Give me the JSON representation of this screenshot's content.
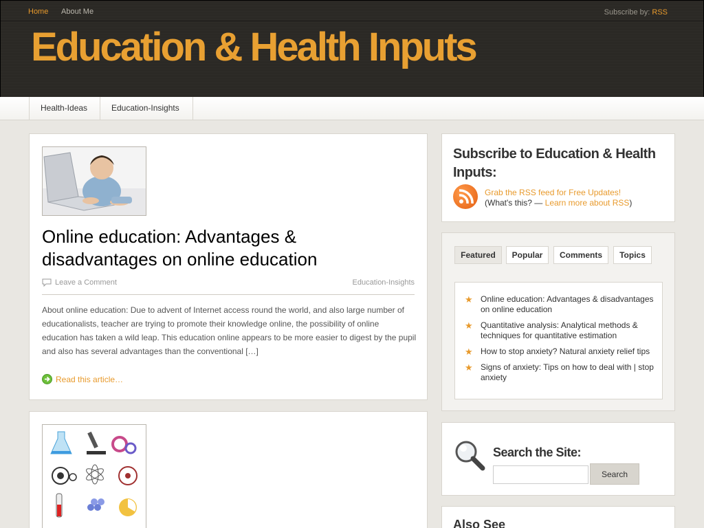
{
  "topbar": {
    "home": "Home",
    "about": "About Me",
    "subscribe_prefix": "Subscribe by:",
    "subscribe_link": "RSS"
  },
  "site": {
    "title": "Education & Health Inputs"
  },
  "categories": [
    "Health-Ideas",
    "Education-Insights"
  ],
  "post1": {
    "title": "Online education: Advantages & disadvantages on online education",
    "comment": "Leave a Comment",
    "category": "Education-Insights",
    "excerpt": "About online education: Due to advent of Internet access round the world, and also large number of educationalists, teacher are trying to promote their knowledge online, the possibility of online education has taken a wild leap.  This education online appears to be more easier to digest by the pupil and also has several advantages than the conventional […]",
    "read_more": "Read this article…"
  },
  "sidebar": {
    "subscribe_heading": "Subscribe to Education & Health Inputs:",
    "rss_grab": "Grab the RSS feed for Free Updates!",
    "rss_whats_prefix": "(What's this? — ",
    "rss_learn": "Learn more about RSS",
    "rss_whats_suffix": ")",
    "tabs": [
      "Featured",
      "Popular",
      "Comments",
      "Topics"
    ],
    "featured": [
      "Online education: Advantages & disadvantages on online education",
      "Quantitative analysis: Analytical methods & techniques for quantitative estimation",
      "How to stop anxiety? Natural anxiety relief tips",
      "Signs of anxiety: Tips on how to deal with | stop anxiety"
    ],
    "search_heading": "Search the Site:",
    "search_value": "",
    "search_button": "Search",
    "also_heading": "Also See"
  },
  "colors": {
    "accent": "#e89a2c",
    "header_bg": "#2b2925",
    "page_bg": "#e9e7e2"
  }
}
